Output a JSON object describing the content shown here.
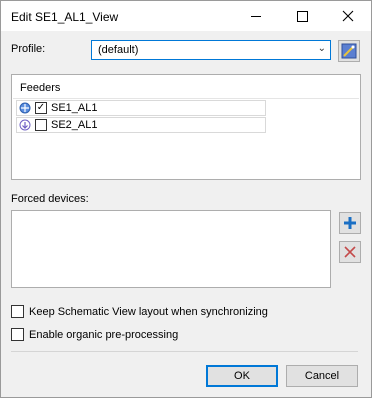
{
  "window": {
    "title": "Edit SE1_AL1_View"
  },
  "profile": {
    "label": "Profile:",
    "selected": "(default)"
  },
  "feeders": {
    "header": "Feeders",
    "items": [
      {
        "label": "SE1_AL1",
        "checked": true,
        "checkmark": "✓"
      },
      {
        "label": "SE2_AL1",
        "checked": false,
        "checkmark": ""
      }
    ]
  },
  "forced_devices": {
    "label": "Forced devices:"
  },
  "options": {
    "keep_layout_label": "Keep Schematic View layout when synchronizing",
    "organic_label": "Enable organic pre-processing"
  },
  "buttons": {
    "ok": "OK",
    "cancel": "Cancel"
  },
  "colors": {
    "accent": "#0078d7",
    "add": "#1a6fc4",
    "remove": "#c44a4a"
  }
}
